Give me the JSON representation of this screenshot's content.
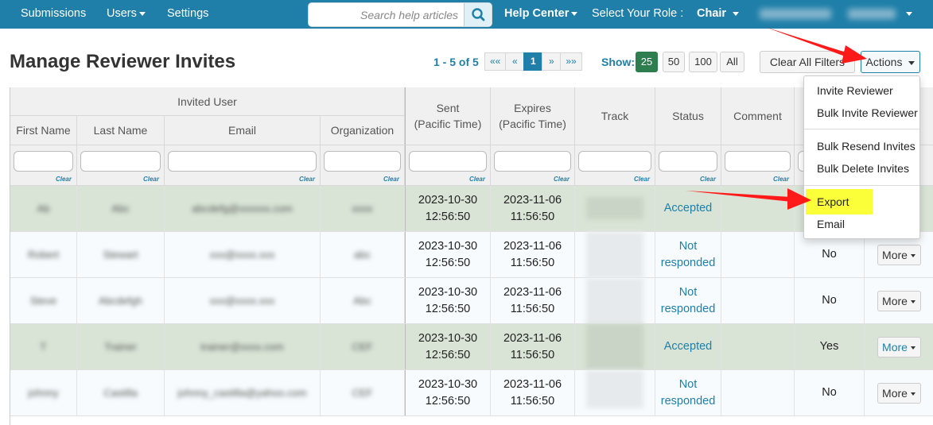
{
  "nav": {
    "submissions": "Submissions",
    "users": "Users",
    "settings": "Settings",
    "search_placeholder": "Search help articles",
    "help_center": "Help Center",
    "role_label": "Select Your Role :",
    "role_value": "Chair"
  },
  "page": {
    "title": "Manage Reviewer Invites"
  },
  "pagination": {
    "range": "1 - 5 of",
    "total": "5",
    "first": "««",
    "prev": "«",
    "current": "1",
    "next": "»",
    "last": "»»"
  },
  "show": {
    "label": "Show:",
    "options": [
      "25",
      "50",
      "100",
      "All"
    ],
    "selected": "25"
  },
  "toolbar": {
    "clear_filters": "Clear All Filters",
    "actions": "Actions"
  },
  "table": {
    "group_header": "Invited User",
    "headers": {
      "first_name": "First Name",
      "last_name": "Last Name",
      "email": "Email",
      "organization": "Organization",
      "sent": "Sent\n(Pacific Time)",
      "expires": "Expires\n(Pacific Time)",
      "track": "Track",
      "status": "Status",
      "comment": "Comment"
    },
    "clear_label": "Clear",
    "rows": [
      {
        "first": "Ab",
        "last": "Abc",
        "email": "abcdefg@xxxxxx.com",
        "org": "xxxx",
        "sent": "2023-10-30\n12:56:50",
        "expires": "2023-11-06\n11:56:50",
        "status": "Accepted",
        "col11": "",
        "more": ""
      },
      {
        "first": "Robert",
        "last": "Stewart",
        "email": "xxx@xxxx.xxx",
        "org": "abc",
        "sent": "2023-10-30\n12:56:50",
        "expires": "2023-11-06\n11:56:50",
        "status": "Not\nresponded",
        "col11": "No",
        "more": "More"
      },
      {
        "first": "Steve",
        "last": "Abcdefgh",
        "email": "xxx@xxxx.xxx",
        "org": "Abc",
        "sent": "2023-10-30\n12:56:50",
        "expires": "2023-11-06\n11:56:50",
        "status": "Not\nresponded",
        "col11": "No",
        "more": "More"
      },
      {
        "first": "T",
        "last": "Trainer",
        "email": "trainer@xxxx.com",
        "org": "CEF",
        "sent": "2023-10-30\n12:56:50",
        "expires": "2023-11-06\n11:56:50",
        "status": "Accepted",
        "col11": "Yes",
        "more": "More"
      },
      {
        "first": "johnny",
        "last": "Castilla",
        "email": "johnny_castilla@yahoo.com",
        "org": "CEF",
        "sent": "2023-10-30\n12:56:50",
        "expires": "2023-11-06\n11:56:50",
        "status": "Not\nresponded",
        "col11": "No",
        "more": "More"
      }
    ]
  },
  "actions_menu": {
    "invite_reviewer": "Invite Reviewer",
    "bulk_invite_reviewer": "Bulk Invite Reviewer",
    "bulk_resend_invites": "Bulk Resend Invites",
    "bulk_delete_invites": "Bulk Delete Invites",
    "export": "Export",
    "email": "Email"
  },
  "colors": {
    "nav_bg": "#1f7fa8",
    "accent": "#1f7fa8",
    "accepted_row": "#d9e4d6",
    "show_active": "#2e7d4f",
    "highlight": "#fbff3a",
    "annotation_arrow": "#ff1a1a"
  },
  "icons": {
    "search": "search-icon",
    "caret": "caret-down-icon",
    "arrow": "annotation-arrow"
  }
}
